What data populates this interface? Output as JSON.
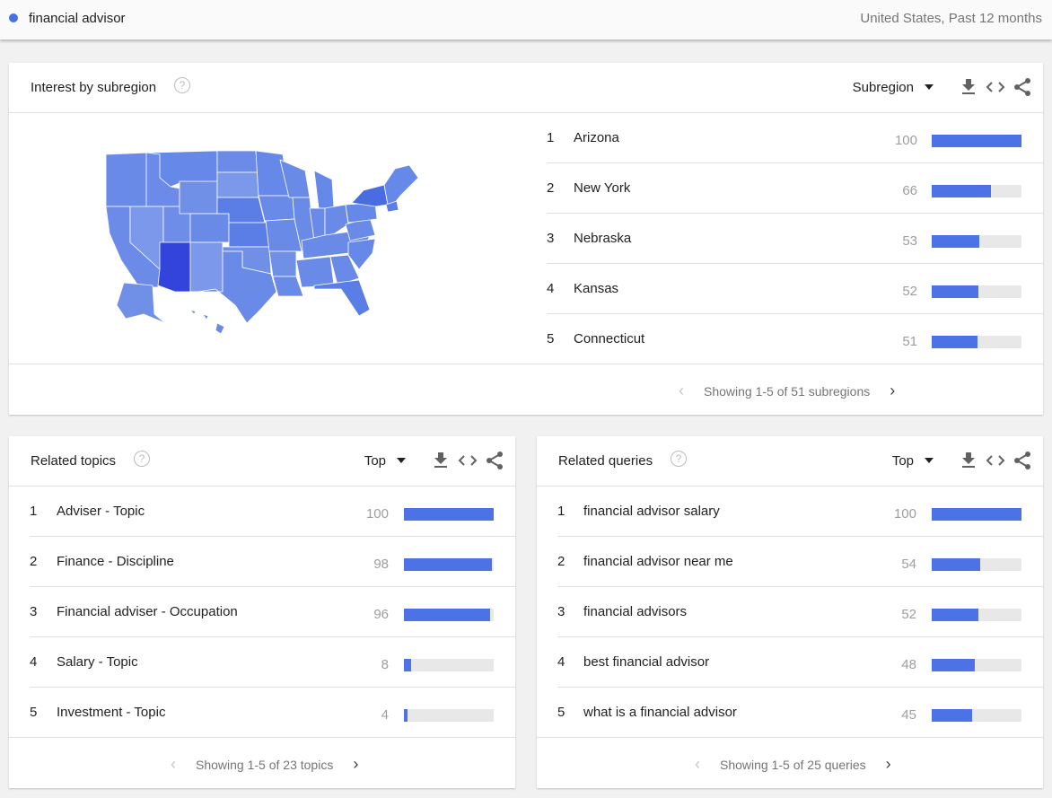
{
  "search": {
    "term": "financial advisor",
    "term_color": "#4a6fe3",
    "scope": "United States, Past 12 months"
  },
  "subregion": {
    "title": "Interest by subregion",
    "help_icon": "?",
    "selector": "Subregion",
    "items": [
      {
        "rank": "1",
        "name": "Arizona",
        "value": "100",
        "pct": 100
      },
      {
        "rank": "2",
        "name": "New York",
        "value": "66",
        "pct": 66
      },
      {
        "rank": "3",
        "name": "Nebraska",
        "value": "53",
        "pct": 53
      },
      {
        "rank": "4",
        "name": "Kansas",
        "value": "52",
        "pct": 52
      },
      {
        "rank": "5",
        "name": "Connecticut",
        "value": "51",
        "pct": 51
      }
    ],
    "pager": "Showing 1-5 of 51 subregions"
  },
  "topics": {
    "title": "Related topics",
    "help_icon": "?",
    "selector": "Top",
    "items": [
      {
        "rank": "1",
        "name": "Adviser - Topic",
        "value": "100",
        "pct": 100
      },
      {
        "rank": "2",
        "name": "Finance - Discipline",
        "value": "98",
        "pct": 98
      },
      {
        "rank": "3",
        "name": "Financial adviser - Occupation",
        "value": "96",
        "pct": 96
      },
      {
        "rank": "4",
        "name": "Salary - Topic",
        "value": "8",
        "pct": 8
      },
      {
        "rank": "5",
        "name": "Investment - Topic",
        "value": "4",
        "pct": 4
      }
    ],
    "pager": "Showing 1-5 of 23 topics"
  },
  "queries": {
    "title": "Related queries",
    "help_icon": "?",
    "selector": "Top",
    "items": [
      {
        "rank": "1",
        "name": "financial advisor salary",
        "value": "100",
        "pct": 100
      },
      {
        "rank": "2",
        "name": "financial advisor near me",
        "value": "54",
        "pct": 54
      },
      {
        "rank": "3",
        "name": "financial advisors",
        "value": "52",
        "pct": 52
      },
      {
        "rank": "4",
        "name": "best financial advisor",
        "value": "48",
        "pct": 48
      },
      {
        "rank": "5",
        "name": "what is a financial advisor",
        "value": "45",
        "pct": 45
      }
    ],
    "pager": "Showing 1-5 of 25 queries"
  },
  "colors": {
    "bar_fill": "#4c72e6",
    "bar_track": "#e8e8e8",
    "map_base": "#6a8ae8",
    "map_light": "#7b98ea",
    "map_mid": "#5a7de6",
    "map_strong": "#4a6ce3",
    "map_max": "#3344dd"
  }
}
